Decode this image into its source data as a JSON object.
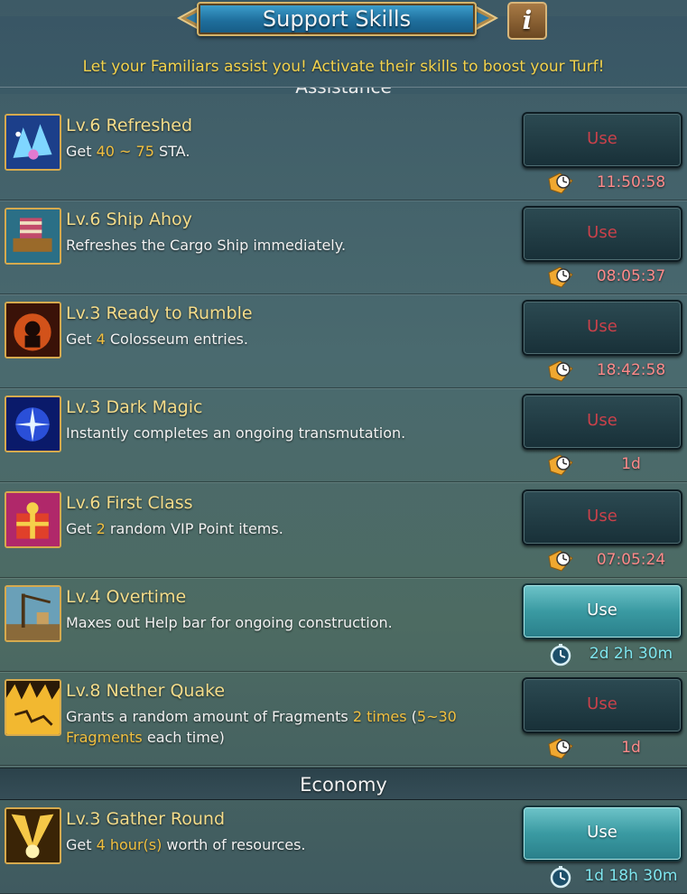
{
  "header": {
    "title": "Support Skills",
    "info_label": "i",
    "subtitle": "Let your Familiars assist you!  Activate their skills to boost your Turf!"
  },
  "sections": {
    "assistance_label": "Assistance",
    "economy_label": "Economy"
  },
  "skills": [
    {
      "name": "Lv.6 Refreshed",
      "desc_parts": [
        "Get ",
        "40 ~ 75",
        " STA."
      ],
      "button": "Use",
      "timer": "11:50:58",
      "state": "cooldown",
      "icon": "refreshed-icon"
    },
    {
      "name": "Lv.6 Ship Ahoy",
      "desc_parts": [
        "Refreshes the Cargo Ship immediately."
      ],
      "button": "Use",
      "timer": "08:05:37",
      "state": "cooldown",
      "icon": "ship-ahoy-icon"
    },
    {
      "name": "Lv.3 Ready to Rumble",
      "desc_parts": [
        "Get ",
        "4",
        " Colosseum entries."
      ],
      "button": "Use",
      "timer": "18:42:58",
      "state": "cooldown",
      "icon": "ready-to-rumble-icon"
    },
    {
      "name": "Lv.3 Dark Magic",
      "desc_parts": [
        "Instantly completes an ongoing transmutation."
      ],
      "button": "Use",
      "timer": "1d",
      "state": "cooldown",
      "icon": "dark-magic-icon"
    },
    {
      "name": "Lv.6 First Class",
      "desc_parts": [
        "Get ",
        "2",
        " random VIP Point items."
      ],
      "button": "Use",
      "timer": "07:05:24",
      "state": "cooldown",
      "icon": "first-class-icon"
    },
    {
      "name": "Lv.4 Overtime",
      "desc_parts": [
        "Maxes out Help bar for ongoing construction."
      ],
      "button": "Use",
      "timer": "2d 2h 30m",
      "state": "ready",
      "icon": "overtime-icon"
    },
    {
      "name": "Lv.8 Nether Quake",
      "desc_parts": [
        "Grants a random amount of Fragments ",
        "2 times",
        " (",
        "5~30 Fragments",
        " each time)"
      ],
      "button": "Use",
      "timer": "1d",
      "state": "cooldown",
      "icon": "nether-quake-icon"
    },
    {
      "name": "Lv.3 Gather Round",
      "desc_parts": [
        "Get ",
        "4 hour(s)",
        " worth of resources."
      ],
      "button": "Use",
      "timer": "1d 18h 30m",
      "state": "ready",
      "icon": "gather-round-icon"
    }
  ],
  "colors": {
    "highlight": "#f2c040",
    "cooldown_text": "#c9414a",
    "timer_cooldown": "#ff8a8a",
    "timer_ready": "#7fe6ef",
    "title_gold": "#f4dc8a"
  }
}
